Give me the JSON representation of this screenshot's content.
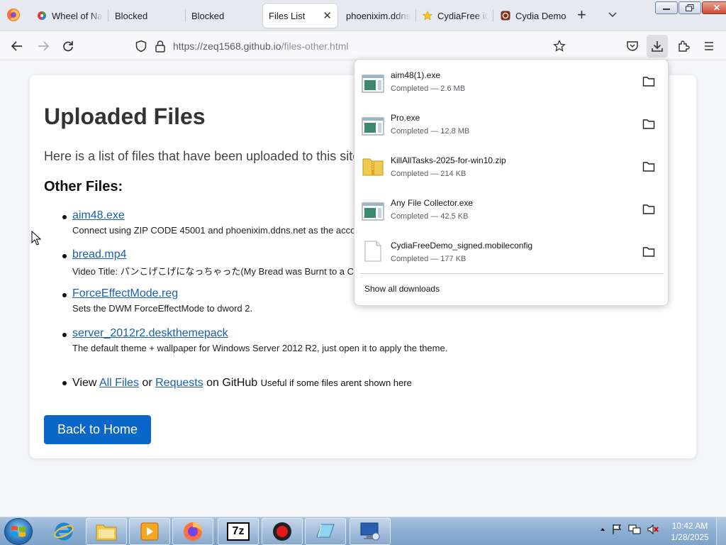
{
  "browser": {
    "tabs": [
      {
        "label": "Wheel of Na",
        "favicon": "wheel-icon",
        "state": "inactive"
      },
      {
        "label": "Blocked",
        "favicon": "",
        "state": "inactive"
      },
      {
        "label": "Blocked",
        "favicon": "",
        "state": "inactive"
      },
      {
        "label": "Files List",
        "favicon": "",
        "state": "active"
      },
      {
        "label": "phoenixim.ddns",
        "favicon": "",
        "state": "inactive"
      },
      {
        "label": "CydiaFree iC",
        "favicon": "star-icon",
        "state": "inactive"
      },
      {
        "label": "Cydia Demo",
        "favicon": "cydia-icon",
        "state": "inactive"
      }
    ],
    "close_tab_glyph": "✕",
    "new_tab_glyph": "+",
    "address": {
      "scheme": "https://",
      "host": "zeq1568.github.io",
      "path": "/files-other.html"
    },
    "window_close_glyph": "✕"
  },
  "page": {
    "title": "Uploaded Files",
    "intro": "Here is a list of files that have been uploaded to this site",
    "section_title": "Other Files:",
    "files": [
      {
        "name": "aim48.exe",
        "desc": "Connect using ZIP CODE 45001 and phoenixim.ddns.net as the acco"
      },
      {
        "name": "bread.mp4",
        "desc": "Video Title: パンこげこげになっちゃった(My Bread was Burnt to a C"
      },
      {
        "name": "ForceEffectMode.reg",
        "desc": "Sets the DWM ForceEffectMode to dword 2."
      },
      {
        "name": "server_2012r2.deskthemepack",
        "desc": "The default theme + wallpaper for Windows Server 2012 R2, just open it to apply the theme."
      }
    ],
    "view_line": {
      "prefix": "View",
      "link_all": "All Files",
      "or": "or",
      "link_requests": "Requests",
      "suffix": "on GitHub",
      "note": "Useful if some files arent shown here"
    },
    "home_button": "Back to Home"
  },
  "downloads": {
    "items": [
      {
        "name": "aim48(1).exe",
        "status": "Completed — 2.6 MB",
        "icon": "exe-file-icon"
      },
      {
        "name": "Pro.exe",
        "status": "Completed — 12.8 MB",
        "icon": "exe-file-icon"
      },
      {
        "name": "KillAllTasks-2025-for-win10.zip",
        "status": "Completed — 214 KB",
        "icon": "zip-folder-icon"
      },
      {
        "name": "Any File Collector.exe",
        "status": "Completed — 42.5 KB",
        "icon": "exe-file-icon"
      },
      {
        "name": "CydiaFreeDemo_signed.mobileconfig",
        "status": "Completed — 177 KB",
        "icon": "blank-file-icon"
      }
    ],
    "show_all": "Show all downloads"
  },
  "taskbar": {
    "apps": [
      "internet-explorer-icon",
      "file-explorer-icon",
      "media-player-icon",
      "firefox-icon",
      "7zip-icon",
      "recorder-icon",
      "glass-app-icon",
      "remote-desktop-icon"
    ],
    "seven_zip_label": "7z",
    "clock": {
      "time": "10:42 AM",
      "date": "1/28/2025"
    }
  },
  "colors": {
    "link": "#1a5fb4",
    "primary_button": "#0a66c9",
    "taskbar": "#8fb0d4"
  }
}
